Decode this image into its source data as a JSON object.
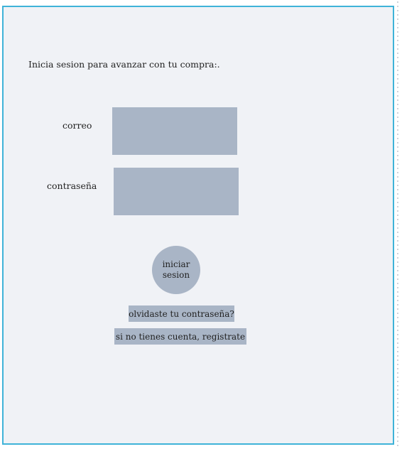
{
  "login": {
    "prompt": "Inicia sesion para avanzar con tu compra:.",
    "email_label": "correo",
    "email_value": "",
    "password_label": "contraseña",
    "password_value": "",
    "submit_label": "iniciar\nsesion",
    "forgot_label": "olvidaste tu contraseña?",
    "register_label": "si no tienes cuenta, registrate"
  },
  "colors": {
    "frame_border": "#3fb3d8",
    "frame_background": "#f0f2f6",
    "control_fill": "#a9b5c6"
  }
}
